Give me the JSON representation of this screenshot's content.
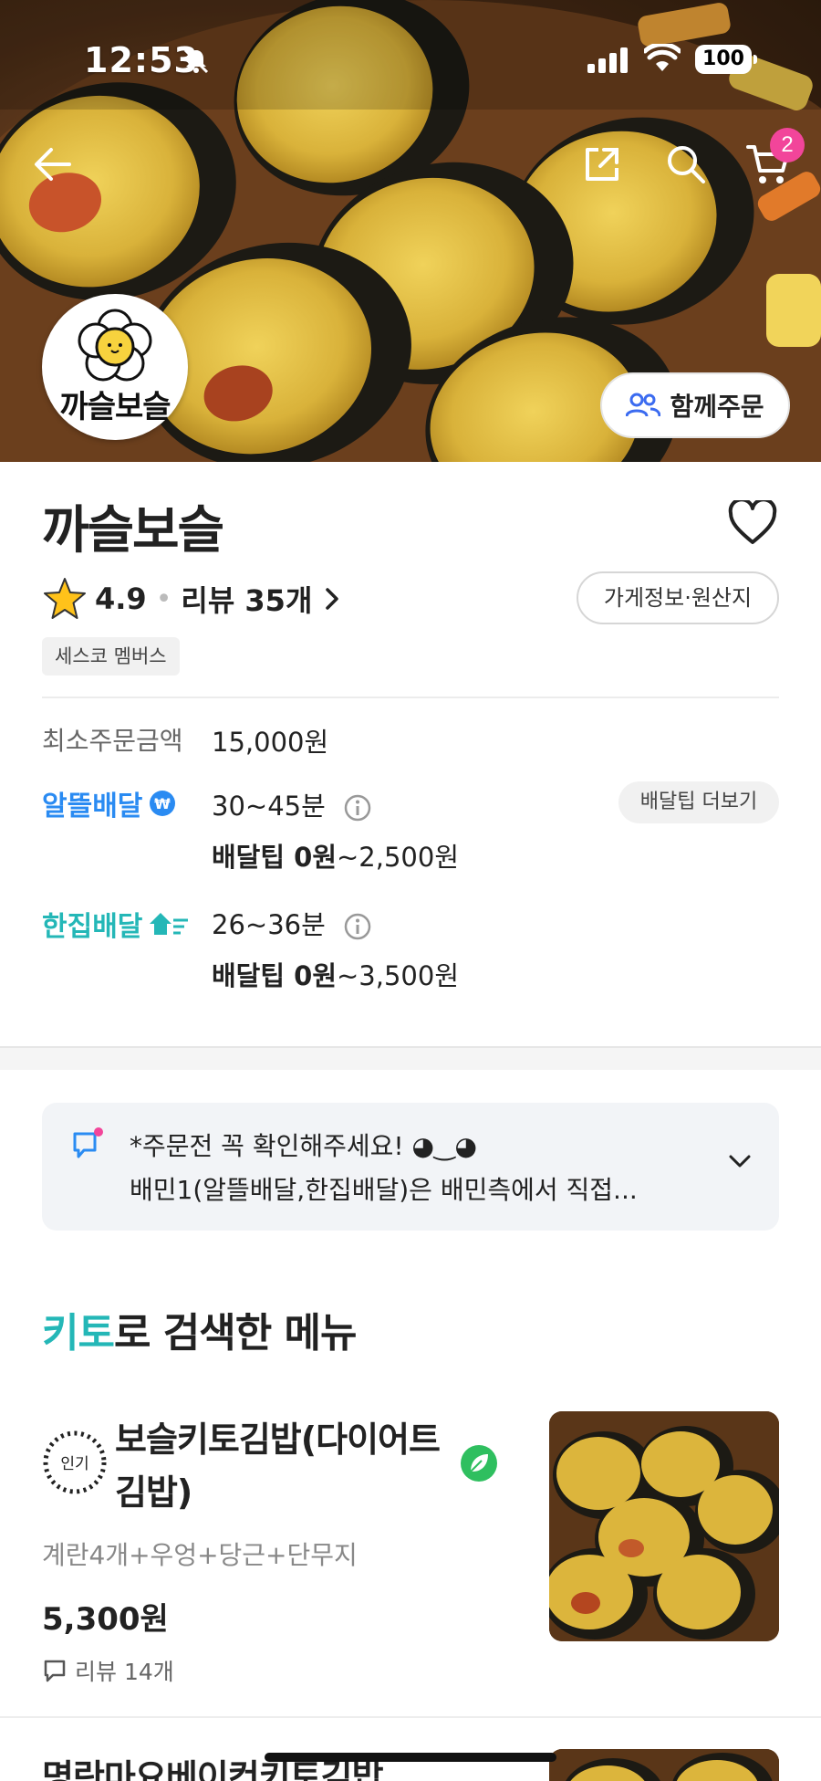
{
  "status_bar": {
    "time": "12:53",
    "battery": "100"
  },
  "header": {
    "cart_count": "2"
  },
  "store": {
    "logo_text": "까슬보슬",
    "together_order_label": "함께주문",
    "name": "까슬보슬",
    "rating": "4.9",
    "reviews_label": "리뷰 35개",
    "info_button": "가게정보·원산지",
    "tag": "세스코 멤버스"
  },
  "order_info": {
    "min_order_label": "최소주문금액",
    "min_order_value": "15,000원",
    "tip_more_button": "배달팁 더보기",
    "delivery_types": [
      {
        "brand": "알뜰배달",
        "time": "30~45분",
        "tip_bold": "배달팁 0원",
        "tip_rest": "~2,500원",
        "color": "#2a8bf2"
      },
      {
        "brand": "한집배달",
        "time": "26~36분",
        "tip_bold": "배달팁 0원",
        "tip_rest": "~3,500원",
        "color": "#24b7b7"
      }
    ]
  },
  "notice": {
    "title": "*주문전 꼭 확인해주세요! ◕‿◕",
    "body": "배민1(알뜰배달,한집배달)은 배민측에서 직접..."
  },
  "menu_section": {
    "title_highlight": "키토",
    "title_rest": "로 검색한 메뉴",
    "items": [
      {
        "badge": "인기",
        "name": "보슬키토김밥(다이어트 김밥)",
        "description": "계란4개+우엉+당근+단무지",
        "price": "5,300원",
        "reviews": "리뷰 14개"
      },
      {
        "name": "명란마요베이컨키토김밥"
      }
    ]
  },
  "colors": {
    "accent_teal": "#24b7b7",
    "accent_blue": "#2a8bf2",
    "badge_pink": "#f2459a",
    "leaf_green": "#2fbf5f"
  }
}
